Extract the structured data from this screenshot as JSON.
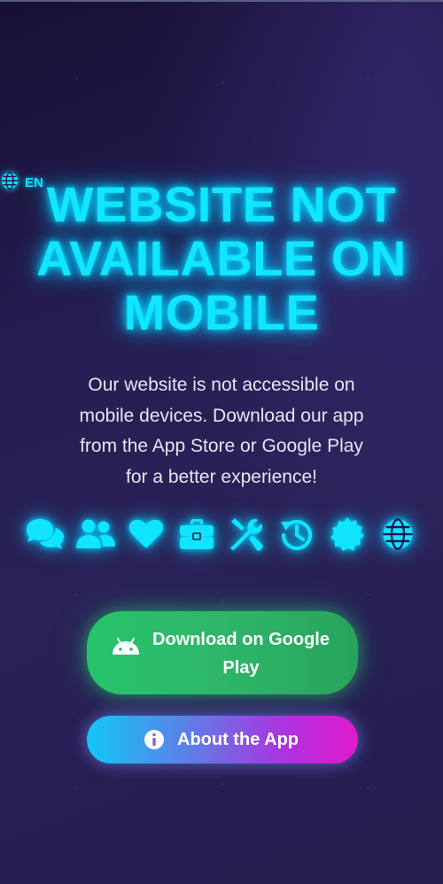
{
  "language": {
    "label": "EN",
    "icon": "globe-icon"
  },
  "heading": {
    "line1": "WEBSITE NOT",
    "line2": "AVAILABLE ON",
    "line3": "MOBILE"
  },
  "description": {
    "line1": "Our website is not accessible on",
    "line2": "mobile devices. Download our app",
    "line3": "from the App Store or Google Play",
    "line4": "for a better experience!"
  },
  "feature_icons": [
    "comments-icon",
    "users-icon",
    "heart-icon",
    "briefcase-icon",
    "tools-icon",
    "history-icon",
    "badge-icon",
    "globe-icon"
  ],
  "buttons": {
    "google": {
      "line1": "Download on Google",
      "line2": "Play",
      "icon": "android-icon"
    },
    "about": {
      "label": "About the App",
      "icon": "info-circle-icon"
    }
  },
  "colors": {
    "neon_cyan": "#12e6ff",
    "background_top": "#171033",
    "background_bottom": "#241d4d",
    "google_green": "#2fb669",
    "about_gradient_start": "#12c7f6",
    "about_gradient_end": "#e01acb"
  }
}
